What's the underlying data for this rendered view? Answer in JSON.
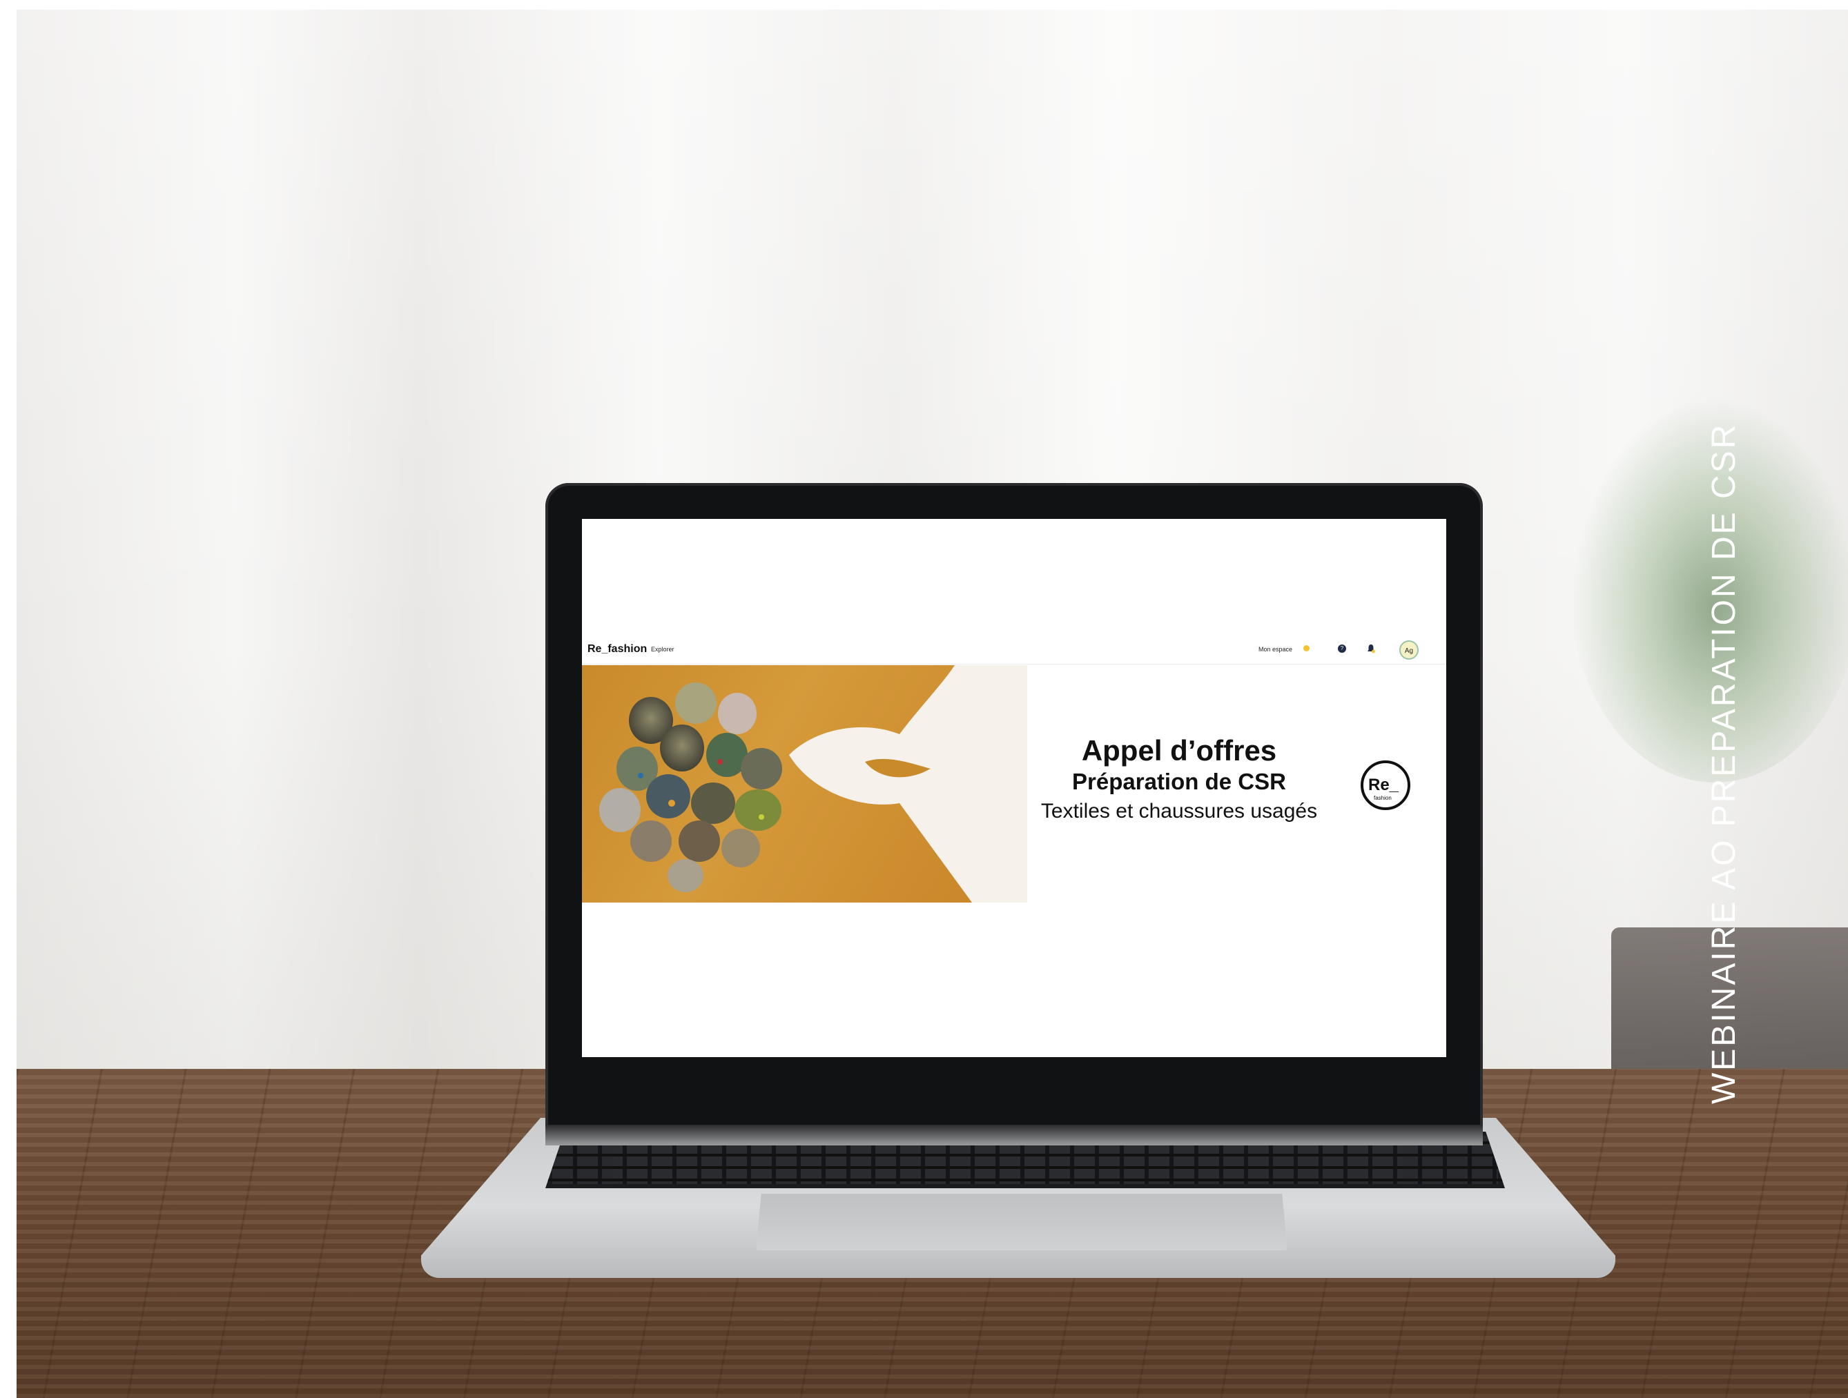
{
  "caption": "WEBINAIRE AO PREPARATION DE CSR",
  "app": {
    "brand": "Re_fashion",
    "nav_explorer": "Explorer",
    "mon_espace": "Mon espace",
    "help": "?",
    "avatar_initials": "Ag"
  },
  "banner": {
    "title": "Appel d’offres",
    "subtitle": "Préparation de CSR",
    "line3": "Textiles et chaussures usagés",
    "logo_text": "Re_",
    "logo_subtext": "fashion"
  },
  "colors": {
    "banner_orange": "#c98a2a",
    "avatar_ring": "#9bc4a6",
    "badge_yellow": "#f4c430"
  }
}
